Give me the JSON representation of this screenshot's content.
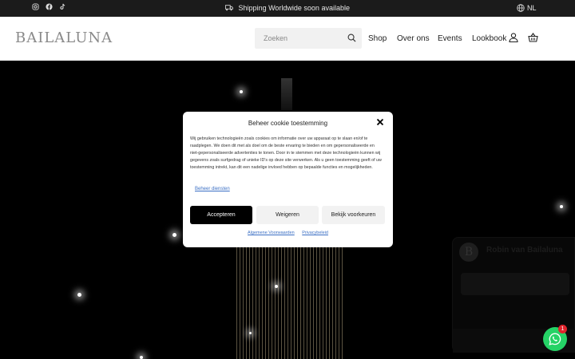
{
  "topbar": {
    "shipping_text": "Shipping Worldwide soon available",
    "language": "NL",
    "socials": [
      "instagram-icon",
      "facebook-icon",
      "tiktok-icon"
    ]
  },
  "header": {
    "logo": "BAILALUNA",
    "search_placeholder": "Zoeken",
    "nav": [
      "Shop",
      "Over ons",
      "Events",
      "Lookbook"
    ]
  },
  "cookie_modal": {
    "title": "Beheer cookie toestemming",
    "body": "Wij gebruiken technologieën zoals cookies om informatie over uw apparaat op te slaan en/of te raadplegen. We doen dit met als doel om de beste ervaring te bieden en om gepersonaliseerde en niet-gepersonaliseerde advertenties te tonen. Door in te stemmen met deze technologieën kunnen wij gegevens zoals surfgedrag of unieke ID's op deze site verwerken. Als u geen toestemming geeft of uw toestemming intrekt, kan dit een nadelige invloed hebben op bepaalde functies en mogelijkheden.",
    "manage_link": "Beheer diensten",
    "accept": "Accepteren",
    "deny": "Weigeren",
    "preferences": "Bekijk voorkeuren",
    "link_terms": "Algemene Voorwaarden",
    "link_privacy": "Privacybeleid"
  },
  "chat": {
    "avatar_letter": "B",
    "name": "Robin van Bailaluna",
    "badge_count": "1"
  },
  "colors": {
    "topbar": "#1b1b1b",
    "accent_link": "#3b6fc4",
    "whatsapp": "#25d366"
  }
}
